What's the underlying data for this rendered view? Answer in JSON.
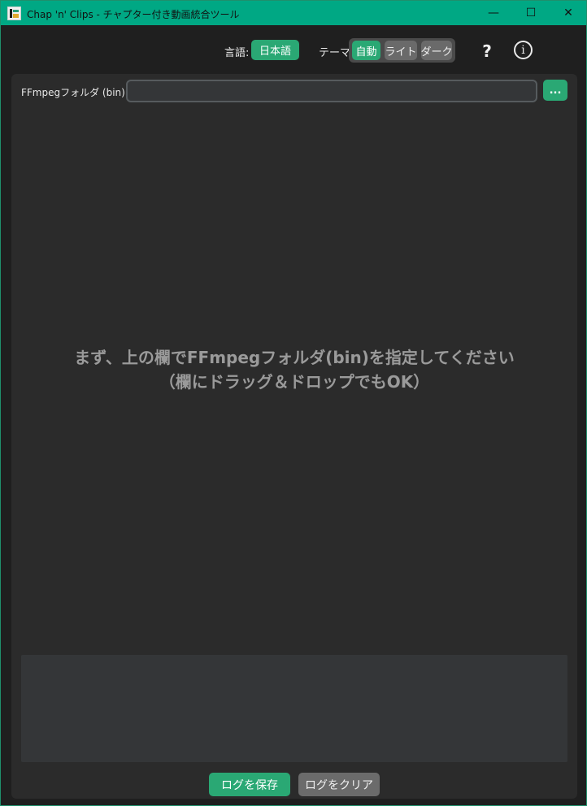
{
  "window": {
    "title": "Chap 'n' Clips - チャプター付き動画統合ツール",
    "accent_color": "#00a884",
    "controls": {
      "minimize": "—",
      "maximize": "☐",
      "close": "✕"
    }
  },
  "toolbar": {
    "language_label": "言語:",
    "language_value": "日本語",
    "theme_label": "テーマ:",
    "theme_options": {
      "auto": "自動",
      "light": "ライト",
      "dark": "ダーク"
    },
    "theme_selected": "auto",
    "help_label": "?",
    "info_label": "i"
  },
  "ffmpeg": {
    "label": "FFmpegフォルダ (bin):",
    "value": "",
    "browse_label": "..."
  },
  "hint": {
    "line1": "まず、上の欄でFFmpegフォルダ(bin)を指定してください",
    "line2": "（欄にドラッグ＆ドロップでもOK）"
  },
  "log": {
    "content": "",
    "save_label": "ログを保存",
    "clear_label": "ログをクリア"
  },
  "colors": {
    "button_green": "#2aa874",
    "button_gray": "#6b6b6b",
    "panel_bg": "#2b2b2b"
  }
}
